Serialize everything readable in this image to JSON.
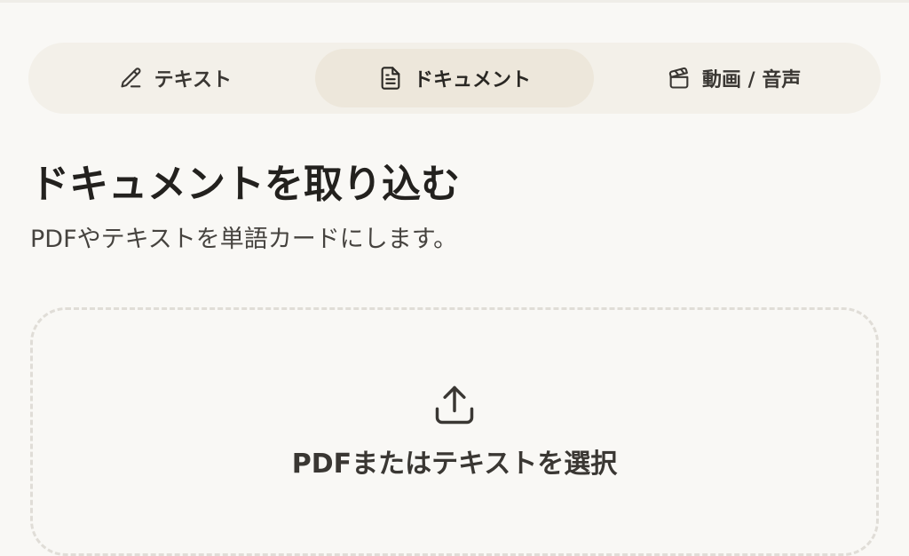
{
  "tabs": [
    {
      "label": "テキスト",
      "icon": "pencil-icon",
      "active": false
    },
    {
      "label": "ドキュメント",
      "icon": "document-icon",
      "active": true
    },
    {
      "label": "動画 / 音声",
      "icon": "clapperboard-icon",
      "active": false
    }
  ],
  "page": {
    "title": "ドキュメントを取り込む",
    "subtitle": "PDFやテキストを単語カードにします。"
  },
  "dropzone": {
    "icon": "upload-icon",
    "label": "PDFまたはテキストを選択"
  },
  "colors": {
    "background": "#f9f8f5",
    "tab_bar": "#f3f0e9",
    "tab_active": "#ede7db",
    "text": "#2f2d2a",
    "dashed_border": "#e0ddd7"
  }
}
